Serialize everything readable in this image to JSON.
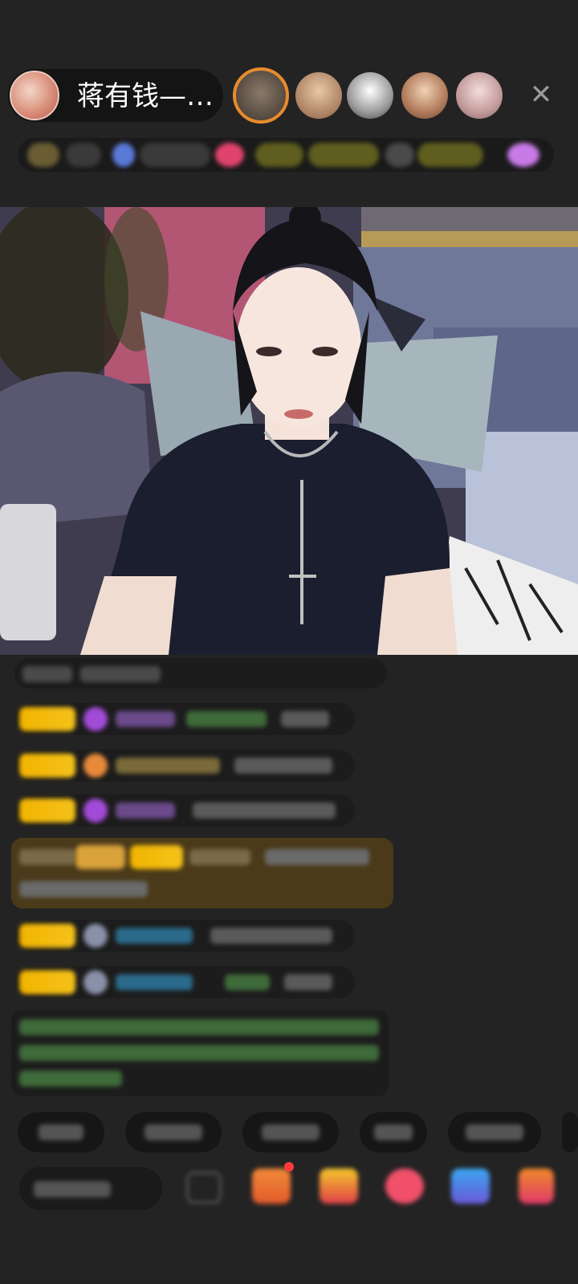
{
  "header": {
    "host_name": "蒋有钱—…",
    "close_icon": "close-icon",
    "viewer_count": 5
  },
  "video": {
    "scene": "live-stream-video"
  },
  "colors": {
    "badge_gold": "#f1b400",
    "chat_bg": "#1c1c1c",
    "notice_bg": "#4a3a1a",
    "green_text": "#7cc24a",
    "purple_icon": "#a24bd8",
    "blue_text": "#2b9ad8"
  }
}
